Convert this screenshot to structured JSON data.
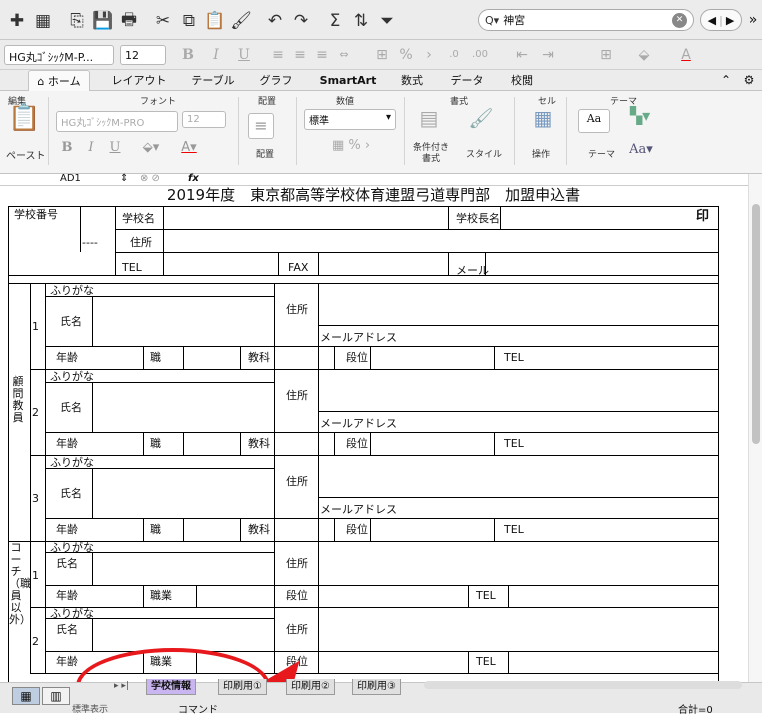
{
  "toolbar": {
    "icons": [
      "new-file-icon",
      "template-icon",
      "open-icon",
      "save-icon",
      "print-icon",
      "cut-icon",
      "copy-icon",
      "paste-icon",
      "format-painter-icon",
      "undo-icon",
      "redo-icon",
      "autosum-icon",
      "sort-icon",
      "filter-icon"
    ],
    "glyphs": [
      "✚",
      "▦",
      "⎘",
      "💾",
      "🖶",
      "✂",
      "⧉",
      "📋",
      "🖌",
      "↶",
      "↷",
      "Σ",
      "⇅",
      "⏷"
    ],
    "search_prefix": "Q▾",
    "search_value": "神宮",
    "overflow": "»"
  },
  "format_bar": {
    "font_name": "HG丸ｺﾞｼｯｸM-P...",
    "font_size": "12",
    "bold": "B",
    "italic": "I",
    "underline": "U",
    "percent": "%",
    "fill_label": "A"
  },
  "ribbon_tabs": [
    "ホーム",
    "レイアウト",
    "テーブル",
    "グラフ",
    "SmartArt",
    "数式",
    "データ",
    "校閲"
  ],
  "ribbon": {
    "groups": [
      "編集",
      "フォント",
      "配置",
      "数値",
      "書式",
      "セル",
      "テーマ"
    ],
    "paste": "ペースト",
    "font_name": "HG丸ｺﾞｼｯｸM-PRO",
    "font_size": "12",
    "align": "配置",
    "number_format": "標準",
    "cond_format": "条件付き書式",
    "style": "スタイル",
    "ops": "操作",
    "theme": "テーマ",
    "aa": "Aa"
  },
  "formula_bar": {
    "cell_ref": "AD1",
    "fx": "fx"
  },
  "sheet": {
    "title": "2019年度　東京都高等学校体育連盟弓道専門部　加盟申込書",
    "school_no": "学校番号",
    "school_name": "学校名",
    "principal": "学校長名",
    "seal": "印",
    "dashes": "----",
    "address": "住所",
    "tel": "TEL",
    "fax": "FAX",
    "mail": "メール",
    "furigana": "ふりがな",
    "name": "氏名",
    "email_address": "メールアドレス",
    "age": "年齢",
    "job": "職",
    "subject": "教科",
    "rank": "段位",
    "occupation": "職業",
    "advisors_label": "顧問教員",
    "coach_label": "コーチ（職員以外）",
    "n1": "1",
    "n2": "2",
    "n3": "3"
  },
  "sheet_tabs": [
    "学校情報",
    "印刷用①",
    "印刷用②",
    "印刷用③"
  ],
  "status": {
    "normal": "標準表示",
    "mode": "コマンド",
    "sum": "合計=0"
  },
  "colors": {
    "active_tab": "#c9b6f0",
    "annotation": "#e8191c"
  }
}
